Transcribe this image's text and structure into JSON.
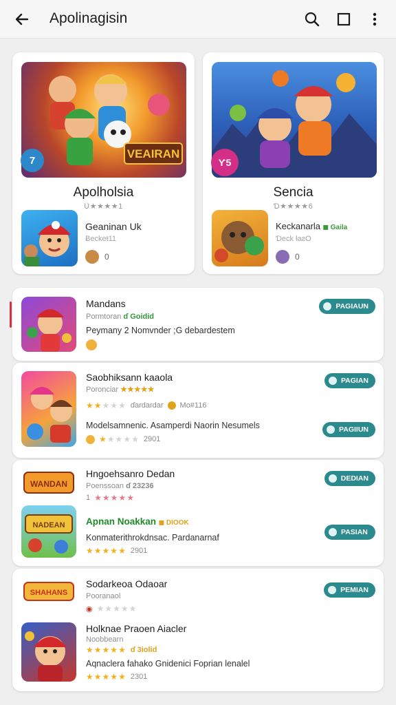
{
  "appbar": {
    "title": "Apolinagisin"
  },
  "featured": [
    {
      "name": "Apolholsia",
      "rating_text": "Ʋ★★★★1",
      "badge": "7",
      "game_name": "Geaninan Uk",
      "game_dev": "Ƀeckeŧ11",
      "count": "0"
    },
    {
      "name": "Sencia",
      "rating_text": "Ɗ★★★★6",
      "badge": "Ƴ5",
      "game_name": "Keckanarla",
      "game_tag": "Gaila",
      "game_dev": "Ɗeck ƚaƨO",
      "count": "0"
    }
  ],
  "rows": [
    {
      "name": "Mandans",
      "sub": "Pormtoran",
      "tag": "ɗ Goidid",
      "tag_color": "#2e9a3a",
      "desc": "Peymany 2 Nomvnder ;G debardestem",
      "button": "PAGIAUN"
    },
    {
      "name": "Saobhiksann kaaola",
      "sub": "Poronciar",
      "tag": "★★★★★",
      "tag_color": "#e0a21a",
      "meta1": "ɗardardar",
      "meta2": "Mo#116",
      "stars1": 2,
      "desc": "Modelsamnenic. Asamperdi Naorin Nesumels",
      "rating2": "2901",
      "stars2": 1,
      "button": "PAGIAN",
      "button2": "PAGIIUN"
    },
    {
      "name": "Hngoehsanro Dedan",
      "sub": "Poenssoan",
      "tag": "ɗ 23236",
      "tag_color": "#888888",
      "meta_num": "1",
      "stars1": 5,
      "promo": "Apnan Noakkan",
      "promo_tag": "DIOOK",
      "desc": "Konmaterithrokdnsac. Pardanarnaf",
      "rating2": "2901",
      "stars2": 5,
      "button": "DEDIAN",
      "button2": "PASIAN"
    },
    {
      "name": "Sodarkeoa Odaoar",
      "sub": "Pooranaol",
      "stars1": 0,
      "game2_name": "Holknae Praoen Aiacler",
      "game2_dev": "Noobbearn",
      "game2_tag": "ɗ 3iolid",
      "desc": "Aqnaclera fahako Gnidenici Foprian lenalel",
      "rating2": "2301",
      "stars2": 5,
      "button": "PEMIAN"
    }
  ],
  "colors": {
    "accent": "#2a8a8e",
    "star": "#f2b01e",
    "indicator": "#d9313c"
  },
  "icons": [
    "back-arrow-icon",
    "search-icon",
    "window-icon",
    "more-vert-icon"
  ]
}
